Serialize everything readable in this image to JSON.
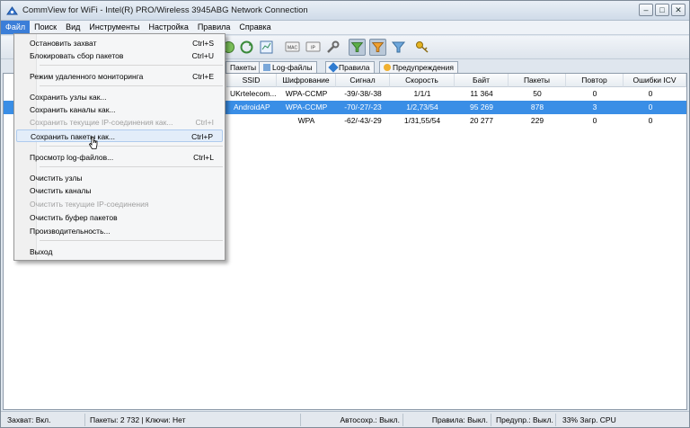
{
  "window": {
    "title": "CommView for WiFi - Intel(R) PRO/Wireless 3945ABG Network Connection",
    "buttons": {
      "minimize": "–",
      "maximize": "□",
      "close": "✕"
    }
  },
  "menubar": [
    "Файл",
    "Поиск",
    "Вид",
    "Инструменты",
    "Настройка",
    "Правила",
    "Справка"
  ],
  "tabs": [
    "Пакеты",
    "Log-файлы",
    "Правила",
    "Предупреждения"
  ],
  "table": {
    "columns": [
      "SSID",
      "Шифрование",
      "Сигнал",
      "Скорость",
      "Байт",
      "Пакеты",
      "Повтор",
      "Ошибки ICV"
    ],
    "rows": [
      {
        "ssid": "UKrtelecom...",
        "enc": "WPA-CCMP",
        "signal": "-39/-38/-38",
        "rate": "1/1/1",
        "bytes": "11 364",
        "packets": "50",
        "retry": "0",
        "icv": "0",
        "selected": false
      },
      {
        "ssid": "AndroidAP",
        "enc": "WPA-CCMP",
        "signal": "-70/-27/-23",
        "rate": "1/2,73/54",
        "bytes": "95 269",
        "packets": "878",
        "retry": "3",
        "icv": "0",
        "selected": true
      },
      {
        "ssid": "",
        "enc": "WPA",
        "signal": "-62/-43/-29",
        "rate": "1/31,55/54",
        "bytes": "20 277",
        "packets": "229",
        "retry": "0",
        "icv": "0",
        "selected": false
      }
    ]
  },
  "file_menu": {
    "items": [
      {
        "label": "Остановить захват",
        "shortcut": "Ctrl+S",
        "disabled": false
      },
      {
        "label": "Блокировать сбор пакетов",
        "shortcut": "Ctrl+U",
        "disabled": false
      },
      {
        "label": "Режим удаленного мониторинга",
        "shortcut": "Ctrl+E",
        "disabled": false
      },
      {
        "label": "Сохранить узлы как...",
        "shortcut": "",
        "disabled": false
      },
      {
        "label": "Сохранить каналы как...",
        "shortcut": "",
        "disabled": false
      },
      {
        "label": "Сохранить текущие IP-соединения как...",
        "shortcut": "Ctrl+I",
        "disabled": true
      },
      {
        "label": "Сохранить пакеты как...",
        "shortcut": "Ctrl+P",
        "disabled": false
      },
      {
        "label": "Просмотр log-файлов...",
        "shortcut": "Ctrl+L",
        "disabled": false
      },
      {
        "label": "Очистить узлы",
        "shortcut": "",
        "disabled": false
      },
      {
        "label": "Очистить каналы",
        "shortcut": "",
        "disabled": false
      },
      {
        "label": "Очистить текущие IP-соединения",
        "shortcut": "",
        "disabled": true
      },
      {
        "label": "Очистить буфер пакетов",
        "shortcut": "",
        "disabled": false
      },
      {
        "label": "Производительность...",
        "shortcut": "",
        "disabled": false
      },
      {
        "label": "Выход",
        "shortcut": "",
        "disabled": false
      }
    ],
    "hovered_index": 6
  },
  "statusbar": {
    "capture": "Захват: Вкл.",
    "packets_keys": "Пакеты: 2 732 | Ключи: Нет",
    "autosave": "Автосохр.: Выкл.",
    "rules": "Правила: Выкл.",
    "alerts": "Предупр.: Выкл.",
    "cpu": "33% Загр. CPU"
  },
  "colors": {
    "selection": "#3a8ee6",
    "menu_active": "#3b7ed8",
    "menu_hover": "#e3edf9"
  }
}
